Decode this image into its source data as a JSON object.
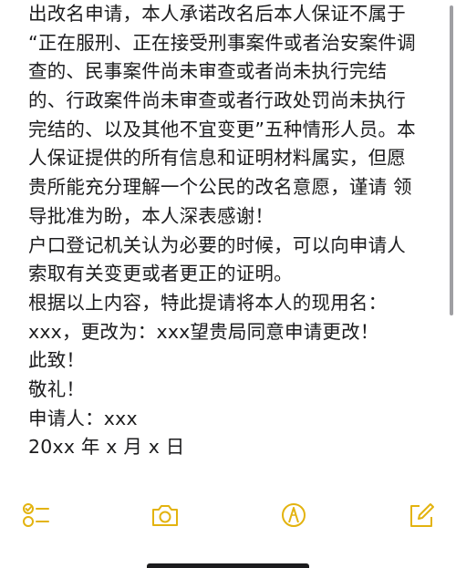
{
  "note": {
    "lines": [
      "出改名申请，本人承诺改名后本人保证不属于",
      "“正在服刑、正在接受刑事案件或者治安案件调",
      "查的、民事案件尚未审查或者尚未执行完结",
      "的、行政案件尚未审查或者行政处罚尚未执行",
      "完结的、以及其他不宜变更”五种情形人员。本",
      "人保证提供的所有信息和证明材料属实，但愿",
      "贵所能充分理解一个公民的改名意愿，谨请 领",
      "导批准为盼，本人深表感谢！",
      "户口登记机关认为必要的时候，可以向申请人",
      "索取有关变更或者更正的证明。",
      "根据以上内容，特此提请将本人的现用名：",
      "xxx，更改为：xxx望贵局同意申请更改！",
      "此致！",
      "敬礼！",
      "申请人：xxx",
      "20xx 年 x 月 x 日"
    ]
  },
  "toolbar": {
    "accent_color": "#e3b30f",
    "icons": [
      "checklist-icon",
      "camera-icon",
      "markup-pen-icon",
      "compose-icon"
    ]
  }
}
